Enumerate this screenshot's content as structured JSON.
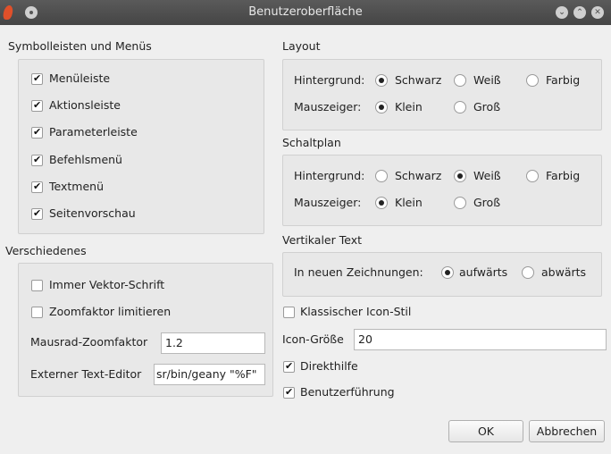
{
  "window": {
    "title": "Benutzeroberfläche"
  },
  "symbolleisten": {
    "heading": "Symbolleisten und Menüs",
    "items": [
      {
        "label": "Menüleiste",
        "checked": true
      },
      {
        "label": "Aktionsleiste",
        "checked": true
      },
      {
        "label": "Parameterleiste",
        "checked": true
      },
      {
        "label": "Befehlsmenü",
        "checked": true
      },
      {
        "label": "Textmenü",
        "checked": true
      },
      {
        "label": "Seitenvorschau",
        "checked": true
      }
    ]
  },
  "verschiedenes": {
    "heading": "Verschiedenes",
    "vektor_label": "Immer Vektor-Schrift",
    "zoom_label": "Zoomfaktor limitieren",
    "mausrad_label": "Mausrad-Zoomfaktor",
    "mausrad_value": "1.2",
    "editor_label": "Externer Text-Editor",
    "editor_value": "sr/bin/geany \"%F\""
  },
  "layout": {
    "heading": "Layout",
    "hintergrund_label": "Hintergrund:",
    "schwarz": "Schwarz",
    "weiss": "Weiß",
    "farbig": "Farbig",
    "mauszeiger_label": "Mauszeiger:",
    "klein": "Klein",
    "gross": "Groß"
  },
  "schaltplan": {
    "heading": "Schaltplan",
    "hintergrund_label": "Hintergrund:",
    "schwarz": "Schwarz",
    "weiss": "Weiß",
    "farbig": "Farbig",
    "mauszeiger_label": "Mauszeiger:",
    "klein": "Klein",
    "gross": "Groß"
  },
  "vertikal": {
    "heading": "Vertikaler Text",
    "label": "In neuen Zeichnungen:",
    "aufwaerts": "aufwärts",
    "abwaerts": "abwärts"
  },
  "misc": {
    "klassisch_label": "Klassischer Icon-Stil",
    "icon_groesse_label": "Icon-Größe",
    "icon_groesse_value": "20",
    "direkthilfe_label": "Direkthilfe",
    "benutzerfuehrung_label": "Benutzerführung"
  },
  "buttons": {
    "ok": "OK",
    "cancel": "Abbrechen"
  }
}
